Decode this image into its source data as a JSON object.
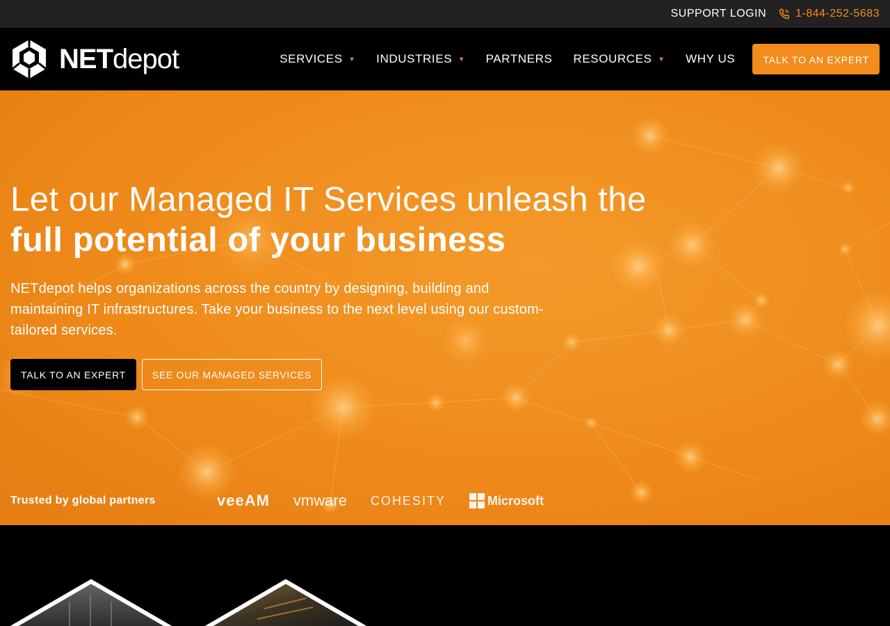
{
  "topbar": {
    "support_login": "SUPPORT LOGIN",
    "phone": "1-844-252-5683"
  },
  "brand": {
    "name_bold": "NET",
    "name_light": "depot",
    "accent_color": "#f28c1c"
  },
  "nav": {
    "items": [
      {
        "label": "SERVICES",
        "has_dropdown": true
      },
      {
        "label": "INDUSTRIES",
        "has_dropdown": true
      },
      {
        "label": "PARTNERS",
        "has_dropdown": false
      },
      {
        "label": "RESOURCES",
        "has_dropdown": true
      },
      {
        "label": "WHY US",
        "has_dropdown": false
      }
    ],
    "cta": "TALK TO AN EXPERT"
  },
  "hero": {
    "headline_light": "Let our Managed IT Services unleash the",
    "headline_bold": "full potential of your business",
    "lead": "NETdepot helps organizations across the country by designing, building and maintaining IT infrastructures. Take your business to the next level using our custom-tailored services.",
    "primary_button": "TALK TO AN EXPERT",
    "secondary_button": "SEE OUR MANAGED SERVICES",
    "partners_label": "Trusted by global partners",
    "partners": [
      "veeAM",
      "vmware",
      "COHESITY",
      "Microsoft"
    ]
  },
  "icons": {
    "logo": "netdepot-cube-logo",
    "phone": "phone-icon",
    "dropdown": "caret-down-icon"
  }
}
